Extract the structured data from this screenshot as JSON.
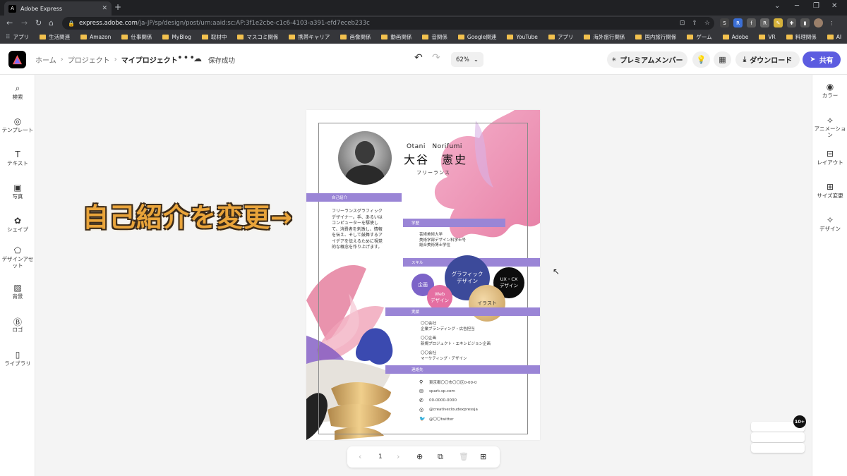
{
  "browser": {
    "tab_title": "Adobe Express",
    "url_host": "express.adobe.com",
    "url_path": "/ja-JP/sp/design/post/urn:aaid:sc:AP:3f1e2cbe-c1c6-4103-a391-efd7eceb233c",
    "bookmarks": [
      "アプリ",
      "生活関連",
      "Amazon",
      "仕事関係",
      "MyBlog",
      "取材中",
      "マスコミ関係",
      "携帯キャリア",
      "画像関係",
      "動画関係",
      "音関係",
      "Google関連",
      "YouTube",
      "アプリ",
      "海外旅行関係",
      "国内旅行関係",
      "ゲーム",
      "Adobe",
      "VR",
      "料理関係",
      "AI"
    ]
  },
  "header": {
    "breadcrumbs": [
      "ホーム",
      "プロジェクト",
      "マイプロジェクト"
    ],
    "save_status": "保存成功",
    "zoom": "62%",
    "premium_label": "プレミアムメンバー",
    "download_label": "ダウンロード",
    "share_label": "共有"
  },
  "left_panel": [
    "検索",
    "テンプレート",
    "テキスト",
    "写真",
    "シェイプ",
    "デザインアセット",
    "背景",
    "ロゴ",
    "ライブラリ"
  ],
  "right_panel": [
    "カラー",
    "アニメーション",
    "レイアウト",
    "サイズ変更",
    "デザイン"
  ],
  "annotation": "自己紹介を変更→",
  "resume": {
    "name_roman": "Otani　Norifumi",
    "name_jp": "大谷　憲史",
    "job": "フリーランス",
    "intro_title": "自己紹介",
    "intro_lines": [
      "フリーランスグラフィック",
      "デザイナー。手、あるいは",
      "コンピューターを駆使し",
      "て、消費者を刺激し、情報",
      "を伝え、そして鼓舞するア",
      "イデアを伝えるために視覚",
      "的な概念を作り上げます。"
    ],
    "edu_title": "学歴",
    "edu_lines": [
      "芸術美術大学",
      "美術学部デザイン科学士号",
      "総合美術博士学位"
    ],
    "skill_title": "スキル",
    "skills": {
      "plan": "企画",
      "web": "Web\nデザイン",
      "graphic": "グラフィック\nデザイン",
      "ux": "UX・CX\nデザイン",
      "illust": "イラスト"
    },
    "work_title": "実績",
    "works": [
      {
        "company": "〇〇会社",
        "desc": "企業ブランディング・広告担当"
      },
      {
        "company": "〇〇企画",
        "desc": "新規プロジェクト・エキシビジョン企画"
      },
      {
        "company": "〇〇会社",
        "desc": "マーケティング・デザイン"
      }
    ],
    "contact_title": "連絡先",
    "contacts": [
      {
        "icon": "location-icon",
        "text": "東京都〇〇市〇〇区0-00-0"
      },
      {
        "icon": "mail-icon",
        "text": "spark.sp.com"
      },
      {
        "icon": "phone-icon",
        "text": "00-0000-0000"
      },
      {
        "icon": "instagram-icon",
        "text": "@creativecloudexpressja"
      },
      {
        "icon": "twitter-icon",
        "text": "@〇〇twitter"
      }
    ]
  },
  "pager": {
    "page": "1"
  },
  "badge": "10+",
  "colors": {
    "accent": "#5c5ce0",
    "section_bar": "#9a85d6",
    "skill_navy": "#3c4a9a",
    "skill_purple": "#7c63c8",
    "skill_pink": "#e56fa2"
  }
}
